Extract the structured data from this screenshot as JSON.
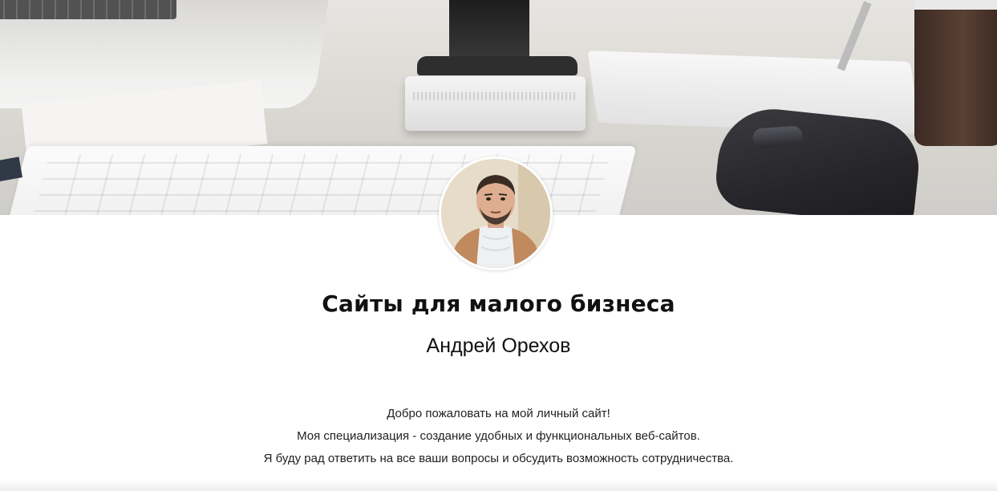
{
  "hero": {
    "image_name": "office-desk-image"
  },
  "profile": {
    "avatar_name": "author-avatar"
  },
  "header": {
    "title": "Сайты для малого бизнеса",
    "author_name": "Андрей Орехов"
  },
  "intro": {
    "lines": [
      "Добро пожаловать на мой личный сайт!",
      "Моя специализация - создание удобных и функциональных веб-сайтов.",
      "Я буду рад ответить на все ваши вопросы и обсудить возможность сотрудничества."
    ]
  },
  "colors": {
    "background": "#ffffff",
    "text": "#111111"
  }
}
